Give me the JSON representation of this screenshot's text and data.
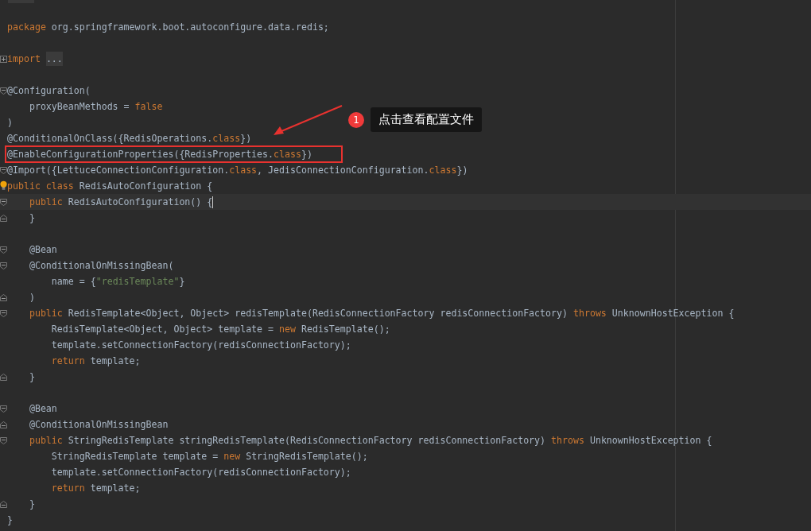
{
  "editor": {
    "lines": [
      {
        "kind": "code",
        "tokens": [
          {
            "kind": "kw",
            "text": "package "
          },
          {
            "kind": "plain",
            "text": "org.springframework.boot.autoconfigure.data.redis;"
          }
        ]
      },
      {
        "kind": "blank"
      },
      {
        "kind": "fold-collapsed",
        "tokens": [
          {
            "kind": "kw",
            "text": "import "
          },
          {
            "kind": "folded",
            "text": "..."
          }
        ]
      },
      {
        "kind": "blank"
      },
      {
        "kind": "fold-start",
        "tokens": [
          {
            "kind": "plain",
            "text": "@Configuration("
          }
        ]
      },
      {
        "kind": "code",
        "tokens": [
          {
            "kind": "plain",
            "text": "    proxyBeanMethods = "
          },
          {
            "kind": "kw",
            "text": "false"
          }
        ]
      },
      {
        "kind": "code",
        "tokens": [
          {
            "kind": "plain",
            "text": ")"
          }
        ]
      },
      {
        "kind": "code",
        "tokens": [
          {
            "kind": "plain",
            "text": "@ConditionalOnClass({RedisOperations."
          },
          {
            "kind": "kw",
            "text": "class"
          },
          {
            "kind": "plain",
            "text": "})"
          }
        ]
      },
      {
        "kind": "code",
        "boxed": true,
        "tokens": [
          {
            "kind": "plain",
            "text": "@EnableConfigurationProperties({RedisProperties."
          },
          {
            "kind": "kw",
            "text": "class"
          },
          {
            "kind": "plain",
            "text": "})"
          }
        ]
      },
      {
        "kind": "fold-start",
        "tokens": [
          {
            "kind": "plain",
            "text": "@Import({LettuceConnectionConfiguration."
          },
          {
            "kind": "kw",
            "text": "class"
          },
          {
            "kind": "plain",
            "text": ", JedisConnectionConfiguration."
          },
          {
            "kind": "kw",
            "text": "class"
          },
          {
            "kind": "plain",
            "text": "})"
          }
        ]
      },
      {
        "kind": "code",
        "bulb": true,
        "tokens": [
          {
            "kind": "kw",
            "text": "public class "
          },
          {
            "kind": "plain",
            "text": "RedisAutoConfiguration {"
          }
        ]
      },
      {
        "kind": "fold-start",
        "current": true,
        "tokens": [
          {
            "kind": "kw",
            "text": "    public "
          },
          {
            "kind": "plain",
            "text": "RedisAutoConfiguration() {"
          }
        ]
      },
      {
        "kind": "fold-end",
        "tokens": [
          {
            "kind": "plain",
            "text": "    }"
          }
        ]
      },
      {
        "kind": "blank"
      },
      {
        "kind": "fold-start",
        "tokens": [
          {
            "kind": "plain",
            "text": "    @Bean"
          }
        ]
      },
      {
        "kind": "fold-start",
        "tokens": [
          {
            "kind": "plain",
            "text": "    @ConditionalOnMissingBean("
          }
        ]
      },
      {
        "kind": "code",
        "tokens": [
          {
            "kind": "plain",
            "text": "        name = {"
          },
          {
            "kind": "str",
            "text": "\"redisTemplate\""
          },
          {
            "kind": "plain",
            "text": "}"
          }
        ]
      },
      {
        "kind": "fold-end",
        "tokens": [
          {
            "kind": "plain",
            "text": "    )"
          }
        ]
      },
      {
        "kind": "fold-start",
        "tokens": [
          {
            "kind": "kw",
            "text": "    public "
          },
          {
            "kind": "plain",
            "text": "RedisTemplate<Object, Object> redisTemplate(RedisConnectionFactory redisConnectionFactory) "
          },
          {
            "kind": "kw",
            "text": "throws "
          },
          {
            "kind": "plain",
            "text": "UnknownHostException {"
          }
        ]
      },
      {
        "kind": "code",
        "tokens": [
          {
            "kind": "plain",
            "text": "        RedisTemplate<Object, Object> template = "
          },
          {
            "kind": "kw",
            "text": "new "
          },
          {
            "kind": "plain",
            "text": "RedisTemplate();"
          }
        ]
      },
      {
        "kind": "code",
        "tokens": [
          {
            "kind": "plain",
            "text": "        template.setConnectionFactory(redisConnectionFactory);"
          }
        ]
      },
      {
        "kind": "code",
        "tokens": [
          {
            "kind": "kw",
            "text": "        return "
          },
          {
            "kind": "plain",
            "text": "template;"
          }
        ]
      },
      {
        "kind": "fold-end",
        "tokens": [
          {
            "kind": "plain",
            "text": "    }"
          }
        ]
      },
      {
        "kind": "blank"
      },
      {
        "kind": "fold-start",
        "tokens": [
          {
            "kind": "plain",
            "text": "    @Bean"
          }
        ]
      },
      {
        "kind": "fold-end",
        "tokens": [
          {
            "kind": "plain",
            "text": "    @ConditionalOnMissingBean"
          }
        ]
      },
      {
        "kind": "fold-start",
        "tokens": [
          {
            "kind": "kw",
            "text": "    public "
          },
          {
            "kind": "plain",
            "text": "StringRedisTemplate stringRedisTemplate(RedisConnectionFactory redisConnectionFactory) "
          },
          {
            "kind": "kw",
            "text": "throws "
          },
          {
            "kind": "plain",
            "text": "UnknownHostException {"
          }
        ]
      },
      {
        "kind": "code",
        "tokens": [
          {
            "kind": "plain",
            "text": "        StringRedisTemplate template = "
          },
          {
            "kind": "kw",
            "text": "new "
          },
          {
            "kind": "plain",
            "text": "StringRedisTemplate();"
          }
        ]
      },
      {
        "kind": "code",
        "tokens": [
          {
            "kind": "plain",
            "text": "        template.setConnectionFactory(redisConnectionFactory);"
          }
        ]
      },
      {
        "kind": "code",
        "tokens": [
          {
            "kind": "kw",
            "text": "        return "
          },
          {
            "kind": "plain",
            "text": "template;"
          }
        ]
      },
      {
        "kind": "fold-end",
        "tokens": [
          {
            "kind": "plain",
            "text": "    }"
          }
        ]
      },
      {
        "kind": "code",
        "tokens": [
          {
            "kind": "plain",
            "text": "}"
          }
        ]
      }
    ]
  },
  "callout": {
    "badge": "1",
    "text": "点击查看配置文件"
  }
}
